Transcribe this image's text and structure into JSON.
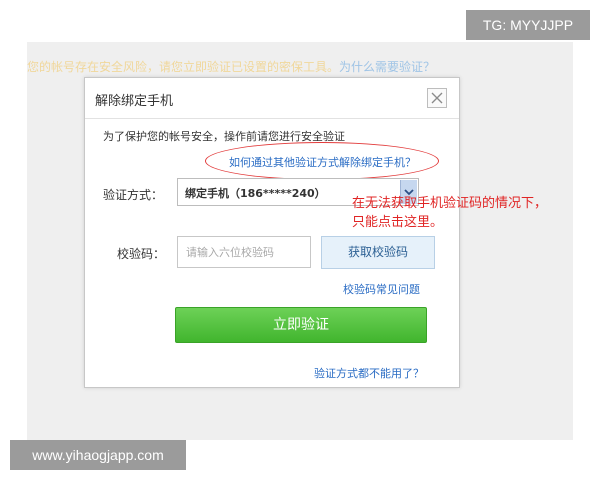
{
  "background": {
    "notice": "您的帐号存在安全风险，请您立即验证已设置的密保工具。",
    "notice_link": "为什么需要验证？"
  },
  "dialog": {
    "title": "解除绑定手机",
    "intro": "为了保护您的帐号安全，操作前请您进行安全验证",
    "alt_link": "如何通过其他验证方式解除绑定手机？",
    "method_label": "验证方式：",
    "method_value": "绑定手机（186*****240）",
    "code_label": "校验码：",
    "code_placeholder": "请输入六位校验码",
    "get_code_button": "获取校验码",
    "faq_link": "校验码常见问题",
    "verify_button": "立即验证",
    "all_fail_link": "验证方式都不能用了？"
  },
  "annotation": {
    "text": "在无法获取手机验证码的情况下，只能点击这里。",
    "color": "#e02424"
  },
  "watermarks": {
    "top": "TG: MYYJJPP",
    "bottom": "www.yihaogjapp.com"
  },
  "colors": {
    "verify_green": "#41b52e",
    "link_blue": "#2a6cc4"
  }
}
